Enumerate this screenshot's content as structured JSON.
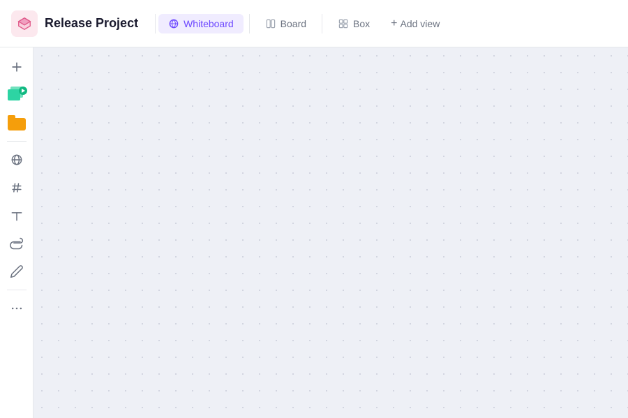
{
  "header": {
    "project_title": "Release Project",
    "tabs": [
      {
        "id": "whiteboard",
        "label": "Whiteboard",
        "active": true
      },
      {
        "id": "board",
        "label": "Board",
        "active": false
      },
      {
        "id": "box",
        "label": "Box",
        "active": false
      }
    ],
    "add_view_label": "Add view"
  },
  "sidebar": {
    "tools": [
      {
        "id": "add",
        "icon": "plus",
        "label": "Add"
      },
      {
        "id": "media",
        "icon": "media-stack",
        "label": "Media"
      },
      {
        "id": "files",
        "icon": "folder",
        "label": "Files"
      },
      {
        "id": "globe",
        "icon": "globe",
        "label": "Globe"
      },
      {
        "id": "hashtag",
        "icon": "hashtag",
        "label": "Hashtag"
      },
      {
        "id": "text",
        "icon": "text",
        "label": "Text"
      },
      {
        "id": "attachment",
        "icon": "attachment",
        "label": "Attachment"
      },
      {
        "id": "draw",
        "icon": "draw",
        "label": "Draw"
      },
      {
        "id": "more",
        "icon": "ellipsis",
        "label": "More"
      }
    ]
  },
  "canvas": {
    "background_color": "#eef0f6",
    "dot_color": "#c8ccd8"
  },
  "icons": {
    "plus": "+",
    "globe": "🌐",
    "hashtag": "#",
    "text": "T",
    "attachment": "🔗",
    "draw": "✏️",
    "ellipsis": "···"
  }
}
